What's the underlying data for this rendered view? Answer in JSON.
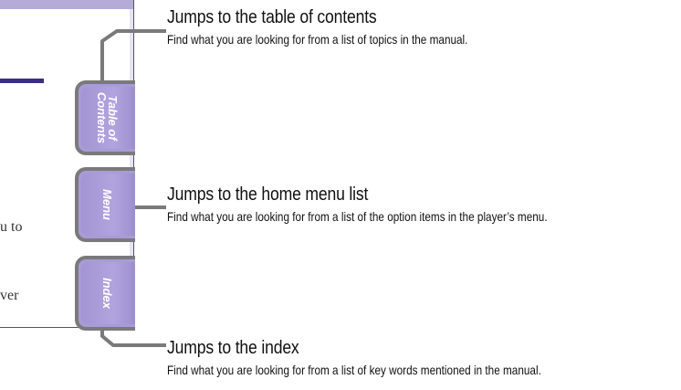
{
  "page_fragment": {
    "line_1": "u to",
    "line_2": "ver"
  },
  "tabs": [
    {
      "label_lines": [
        "Table of",
        "Contents"
      ]
    },
    {
      "label_lines": [
        "Menu"
      ]
    },
    {
      "label_lines": [
        "Index"
      ]
    }
  ],
  "callouts": [
    {
      "title": "Jumps to the table of contents",
      "body": "Find what you are looking for from a list of topics in the manual."
    },
    {
      "title": "Jumps to the home menu list",
      "body": "Find what you are looking for from a list of the option items in the player’s menu."
    },
    {
      "title": "Jumps to the index",
      "body": "Find what you are looking for from a list of key words mentioned in the manual."
    }
  ],
  "colors": {
    "tab_fill": "#a99bd6",
    "tab_border": "#7a7a7a",
    "heading_rule": "#3b2f80",
    "top_strip": "#b4acd6",
    "leader_line": "#7a7a7a"
  }
}
